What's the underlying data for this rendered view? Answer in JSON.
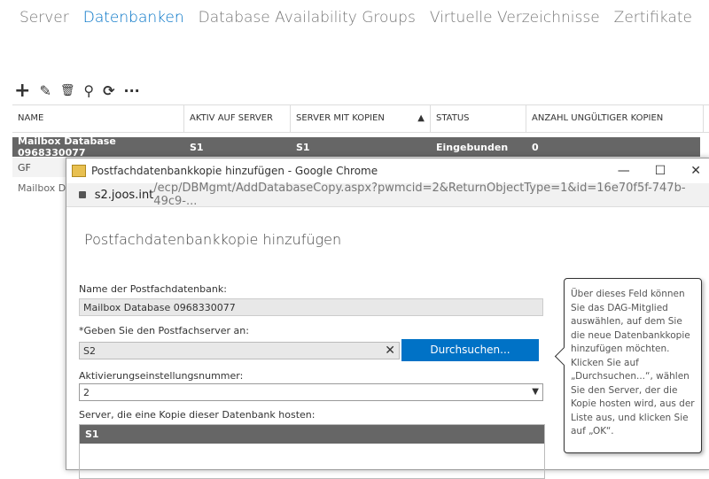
{
  "nav": [
    "Server",
    "Datenbanken",
    "Database Availability Groups",
    "Virtuelle Verzeichnisse",
    "Zertifikate"
  ],
  "toolbar": {
    "add": "+",
    "edit": "✎",
    "delete": "🗑",
    "search": "⚲",
    "refresh": "⟳",
    "more": "···"
  },
  "table": {
    "headers": [
      "NAME",
      "AKTIV AUF SERVER",
      "SERVER MIT KOPIEN",
      "STATUS",
      "ANZAHL UNGÜLTIGER KOPIEN"
    ],
    "sort_icon": "▲",
    "rows": [
      [
        "Mailbox Database 0968330077",
        "S1",
        "S1",
        "Eingebunden",
        "0"
      ],
      [
        "GF"
      ],
      [
        "Mailbox D"
      ]
    ]
  },
  "popup": {
    "title": "Postfachdatenbankkopie hinzufügen - Google Chrome",
    "min": "—",
    "max": "☐",
    "close": "✕",
    "url_host": "s2.joos.int",
    "url_path": "/ecp/DBMgmt/AddDatabaseCopy.aspx?pwmcid=2&ReturnObjectType=1&id=16e70f5f-747b-49c9-...",
    "heading": "Postfachdatenbankkopie hinzufügen",
    "db_label": "Name der Postfachdatenbank:",
    "db_value": "Mailbox Database 0968330077",
    "server_label": "*Geben Sie den Postfachserver an:",
    "server_value": "S2",
    "clear": "✕",
    "browse": "Durchsuchen...",
    "act_label": "Aktivierungseinstellungsnummer:",
    "act_value": "2",
    "act_arrow": "▼",
    "hosts_label": "Server, die eine Kopie dieser Datenbank hosten:",
    "hosts": [
      "S1"
    ]
  },
  "tooltip": "Über dieses Feld können Sie das DAG-Mitglied auswählen, auf dem Sie die neue Datenbankkopie hinzufügen möchten. Klicken Sie auf „Durchsuchen...“, wählen Sie den Server, der die Kopie hosten wird, aus der Liste aus, und klicken Sie auf „OK“."
}
